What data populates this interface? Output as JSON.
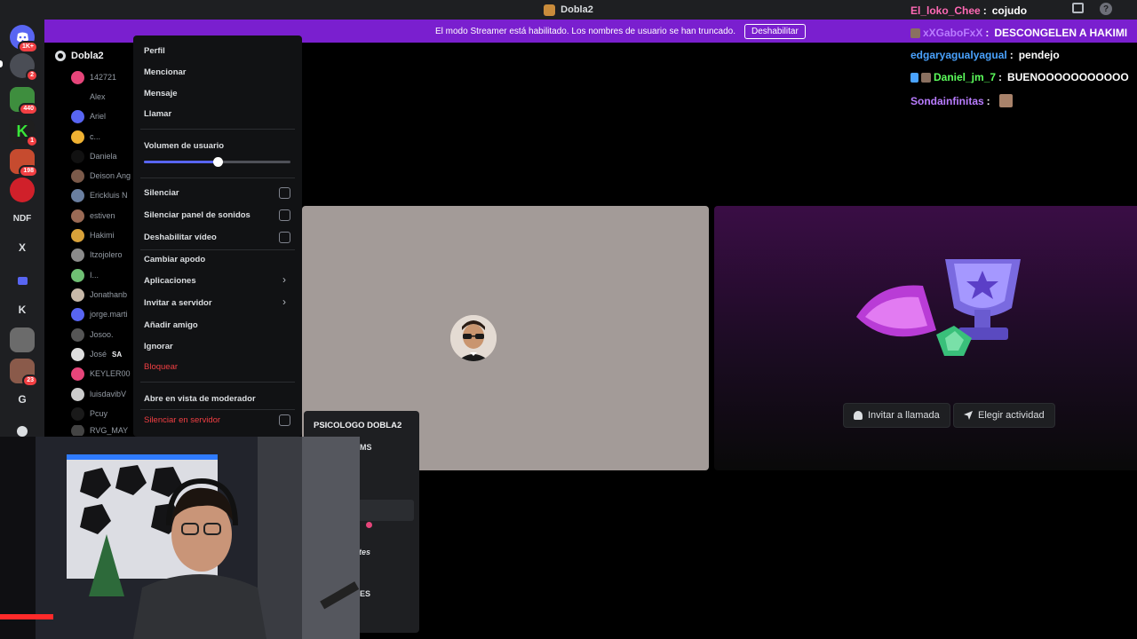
{
  "window": {
    "title": "Dobla2"
  },
  "banner": {
    "text": "El modo Streamer está habilitado. Los nombres de usuario se han truncado.",
    "button": "Deshabilitar"
  },
  "rail": {
    "badges": [
      "1K+",
      "2",
      "440",
      "1",
      "198",
      "23"
    ],
    "letters": [
      "NDF",
      "X",
      "K",
      "G"
    ]
  },
  "members": {
    "server_name": "Dobla2",
    "list": [
      "142721",
      "Alex",
      "Ariel",
      "c...",
      "Daniela",
      "Deison Ang",
      "Erickluis N",
      "estiven",
      "Hakimi",
      "Itzojolero",
      "I...",
      "Jonathanb",
      "jorge.marti",
      "Josoo.",
      "José",
      "KEYLER00",
      "luisdavibV",
      "Pcuy",
      "RVG_MAY"
    ],
    "jose_tag": "SA"
  },
  "context_menu": {
    "profile": "Perfil",
    "mention": "Mencionar",
    "message": "Mensaje",
    "call": "Llamar",
    "volume_label": "Volumen de usuario",
    "volume_level": 0.5,
    "mute": "Silenciar",
    "mute_soundboard": "Silenciar panel de sonidos",
    "disable_video": "Deshabilitar vídeo",
    "change_nickname": "Cambiar apodo",
    "apps": "Aplicaciones",
    "invite_server": "Invitar a servidor",
    "add_friend": "Añadir amigo",
    "ignore": "Ignorar",
    "block": "Bloquear",
    "moderator_view": "Abre en vista de moderador",
    "server_mute": "Silenciar en servidor"
  },
  "stage": {
    "invite_call": "Invitar a llamada",
    "choose_activity": "Elegir actividad"
  },
  "popout": {
    "title": "PSICOLOGO DOBLA2",
    "fragments": [
      "MS",
      "tes",
      "ES"
    ]
  },
  "chat": [
    {
      "user": "El_loko_Chee",
      "sep": ":",
      "msg": "cojudo",
      "color": "#ff69b4"
    },
    {
      "user": "xXGaboFxX",
      "sep": ":",
      "msg": "DESCONGELEN A HAKIMI",
      "color": "#b97cff"
    },
    {
      "user": "edgaryagualyagual",
      "sep": ":",
      "msg": "pendejo",
      "color": "#4aa3ff"
    },
    {
      "user": "Daniel_jm_7",
      "sep": ":",
      "msg": "BUENOOOOOOOOOOO",
      "color": "#5cff5c"
    },
    {
      "user": "Sondainfinitas",
      "sep": ":",
      "msg": "",
      "color": "#b97cff"
    }
  ],
  "colors": {
    "banner": "#7a1fcf",
    "accent": "#5865f2",
    "danger": "#f23f43"
  }
}
